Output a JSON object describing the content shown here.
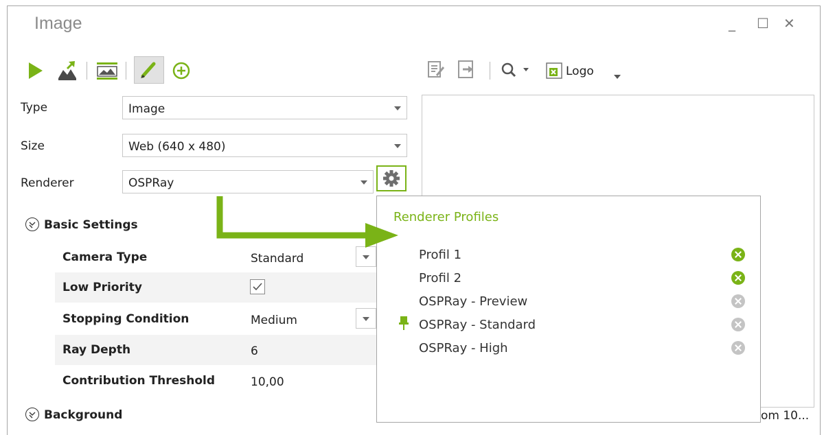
{
  "window": {
    "title": "Image",
    "minimize": "_",
    "maximize": "☐",
    "close": "✕"
  },
  "toolbar": {
    "logo_label": "Logo"
  },
  "form": {
    "type_label": "Type",
    "type_value": "Image",
    "size_label": "Size",
    "size_value": "Web (640 x 480)",
    "renderer_label": "Renderer",
    "renderer_value": "OSPRay"
  },
  "basic_settings": {
    "title": "Basic Settings",
    "rows": [
      {
        "key": "Camera Type",
        "value": "Standard"
      },
      {
        "key": "Low Priority",
        "value": ""
      },
      {
        "key": "Stopping Condition",
        "value": "Medium"
      },
      {
        "key": "Ray Depth",
        "value": "6"
      },
      {
        "key": "Contribution Threshold",
        "value": "10,00"
      }
    ]
  },
  "background": {
    "title": "Background"
  },
  "popup": {
    "title": "Renderer Profiles",
    "profiles": [
      {
        "name": "Profil 1",
        "deletable": true
      },
      {
        "name": "Profil 2",
        "deletable": true
      },
      {
        "name": "OSPRay - Preview",
        "deletable": false
      },
      {
        "name": "OSPRay - Standard",
        "deletable": false,
        "pinned": true
      },
      {
        "name": "OSPRay - High",
        "deletable": false
      }
    ]
  },
  "zoom": {
    "text": "om 10..."
  },
  "colors": {
    "accent": "#7ab317",
    "border": "#c8c8c8"
  }
}
